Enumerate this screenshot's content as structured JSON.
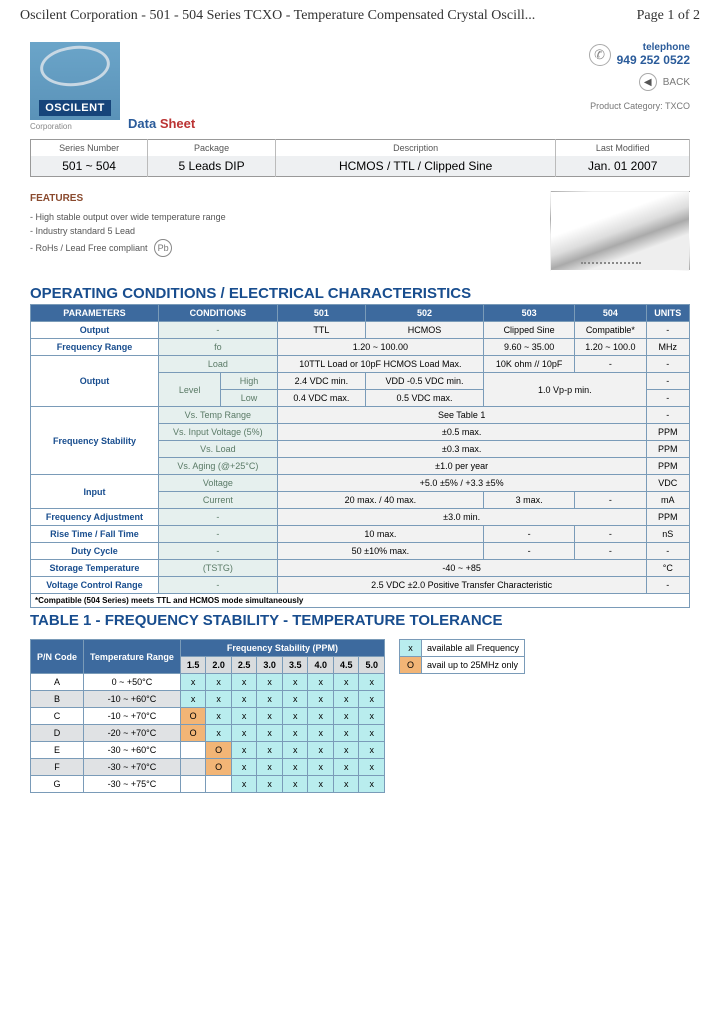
{
  "page_header": {
    "left": "Oscilent Corporation - 501 - 504 Series TCXO - Temperature Compensated Crystal Oscill...",
    "right": "Page 1 of 2"
  },
  "logo": {
    "name": "OSCILENT",
    "corp": "Corporation"
  },
  "doc_label": {
    "data": "Data",
    "sheet": "Sheet"
  },
  "contact": {
    "tel_label": "telephone",
    "tel_number": "949 252 0522",
    "back": "BACK",
    "prod_cat_label": "Product Category:",
    "prod_cat_value": "TXCO"
  },
  "series_header": [
    "Series Number",
    "Package",
    "Description",
    "Last Modified"
  ],
  "series_row": [
    "501 ~ 504",
    "5 Leads DIP",
    "HCMOS / TTL / Clipped Sine",
    "Jan. 01 2007"
  ],
  "features": {
    "title": "FEATURES",
    "items": [
      "- High stable output over wide temperature range",
      "- Industry standard 5 Lead",
      "- RoHs / Lead Free compliant"
    ],
    "pb": "Pb"
  },
  "section1": "OPERATING CONDITIONS / ELECTRICAL CHARACTERISTICS",
  "spec_headers": [
    "PARAMETERS",
    "CONDITIONS",
    "501",
    "502",
    "503",
    "504",
    "UNITS"
  ],
  "spec": {
    "output": {
      "p": "Output",
      "c": "-",
      "v501": "TTL",
      "v502": "HCMOS",
      "v503": "Clipped Sine",
      "v504": "Compatible*",
      "u": "-"
    },
    "freq_range": {
      "p": "Frequency Range",
      "c": "fo",
      "v12": "1.20 ~ 100.00",
      "v503": "9.60 ~ 35.00",
      "v504": "1.20 ~ 100.0",
      "u": "MHz"
    },
    "out_load": {
      "p": "Output",
      "c": "Load",
      "v12": "10TTL Load or 10pF HCMOS Load Max.",
      "v503": "10K ohm // 10pF",
      "v504": "-",
      "u": "-"
    },
    "out_level_lbl": "Level",
    "out_high": {
      "c": "High",
      "v501": "2.4 VDC min.",
      "v502": "VDD -0.5 VDC min.",
      "v5034": "1.0 Vp-p min.",
      "u": "-"
    },
    "out_low": {
      "c": "Low",
      "v501": "0.4 VDC max.",
      "v502": "0.5 VDC max.",
      "u": "-"
    },
    "fs": {
      "p": "Frequency Stability"
    },
    "fs1": {
      "c": "Vs. Temp Range",
      "v": "See Table 1",
      "u": "-"
    },
    "fs2": {
      "c": "Vs. Input Voltage (5%)",
      "v": "±0.5 max.",
      "u": "PPM"
    },
    "fs3": {
      "c": "Vs. Load",
      "v": "±0.3 max.",
      "u": "PPM"
    },
    "fs4": {
      "c": "Vs. Aging (@+25°C)",
      "v": "±1.0 per year",
      "u": "PPM"
    },
    "input": {
      "p": "Input"
    },
    "in_v": {
      "c": "Voltage",
      "v": "+5.0 ±5% / +3.3 ±5%",
      "u": "VDC"
    },
    "in_c": {
      "c": "Current",
      "v12": "20 max. / 40 max.",
      "v503": "3 max.",
      "v504": "-",
      "u": "mA"
    },
    "fadj": {
      "p": "Frequency Adjustment",
      "c": "-",
      "v": "±3.0 min.",
      "u": "PPM"
    },
    "rise": {
      "p": "Rise Time / Fall Time",
      "c": "-",
      "v12": "10 max.",
      "v503": "-",
      "v504": "-",
      "u": "nS"
    },
    "duty": {
      "p": "Duty Cycle",
      "c": "-",
      "v12": "50 ±10% max.",
      "v503": "-",
      "v504": "-",
      "u": "-"
    },
    "stg": {
      "p": "Storage Temperature",
      "c": "(TSTG)",
      "v": "-40 ~ +85",
      "u": "°C"
    },
    "vcr": {
      "p": "Voltage Control Range",
      "c": "-",
      "v": "2.5 VDC ±2.0 Positive Transfer Characteristic",
      "u": "-"
    },
    "compat": "*Compatible (504 Series) meets TTL and HCMOS mode simultaneously"
  },
  "section2": "TABLE 1 -  FREQUENCY STABILITY - TEMPERATURE TOLERANCE",
  "t1_headers": {
    "pn": "P/N Code",
    "temp": "Temperature Range",
    "fs": "Frequency Stability (PPM)"
  },
  "t1_cols": [
    "1.5",
    "2.0",
    "2.5",
    "3.0",
    "3.5",
    "4.0",
    "4.5",
    "5.0"
  ],
  "t1_rows": [
    {
      "code": "A",
      "temp": "0 ~ +50°C",
      "cells": [
        "x",
        "x",
        "x",
        "x",
        "x",
        "x",
        "x",
        "x"
      ]
    },
    {
      "code": "B",
      "temp": "-10 ~ +60°C",
      "cells": [
        "x",
        "x",
        "x",
        "x",
        "x",
        "x",
        "x",
        "x"
      ]
    },
    {
      "code": "C",
      "temp": "-10 ~ +70°C",
      "cells": [
        "O",
        "x",
        "x",
        "x",
        "x",
        "x",
        "x",
        "x"
      ]
    },
    {
      "code": "D",
      "temp": "-20 ~ +70°C",
      "cells": [
        "O",
        "x",
        "x",
        "x",
        "x",
        "x",
        "x",
        "x"
      ]
    },
    {
      "code": "E",
      "temp": "-30 ~ +60°C",
      "cells": [
        "",
        "O",
        "x",
        "x",
        "x",
        "x",
        "x",
        "x"
      ]
    },
    {
      "code": "F",
      "temp": "-30 ~ +70°C",
      "cells": [
        "",
        "O",
        "x",
        "x",
        "x",
        "x",
        "x",
        "x"
      ]
    },
    {
      "code": "G",
      "temp": "-30 ~ +75°C",
      "cells": [
        "",
        "",
        "x",
        "x",
        "x",
        "x",
        "x",
        "x"
      ]
    }
  ],
  "legend": {
    "x": "x",
    "x_text": "available all Frequency",
    "o": "O",
    "o_text": "avail up to 25MHz only"
  }
}
